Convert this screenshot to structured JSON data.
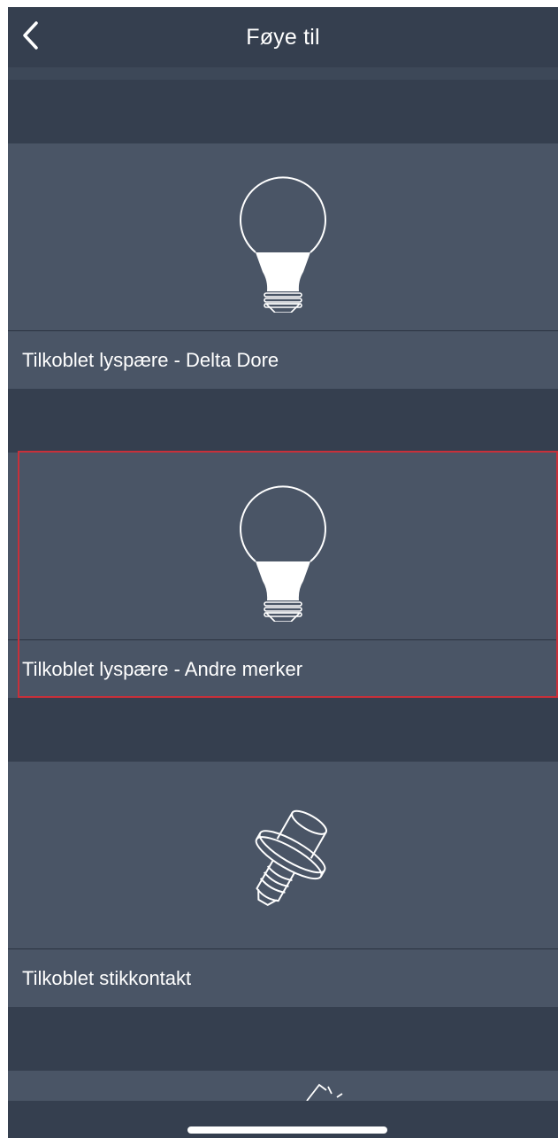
{
  "header": {
    "title": "Føye til",
    "back_icon": "chevron-left-icon"
  },
  "items": [
    {
      "label": "Tilkoblet lyspære - Delta Dore",
      "icon": "light-bulb-icon",
      "selected": false
    },
    {
      "label": "Tilkoblet lyspære - Andre merker",
      "icon": "light-bulb-icon",
      "selected": true
    },
    {
      "label": "Tilkoblet stikkontakt",
      "icon": "socket-adapter-icon",
      "selected": false
    }
  ],
  "colors": {
    "background": "#353f4f",
    "card": "#4a5566",
    "selection_outline": "#c8303a",
    "text": "#ffffff"
  }
}
